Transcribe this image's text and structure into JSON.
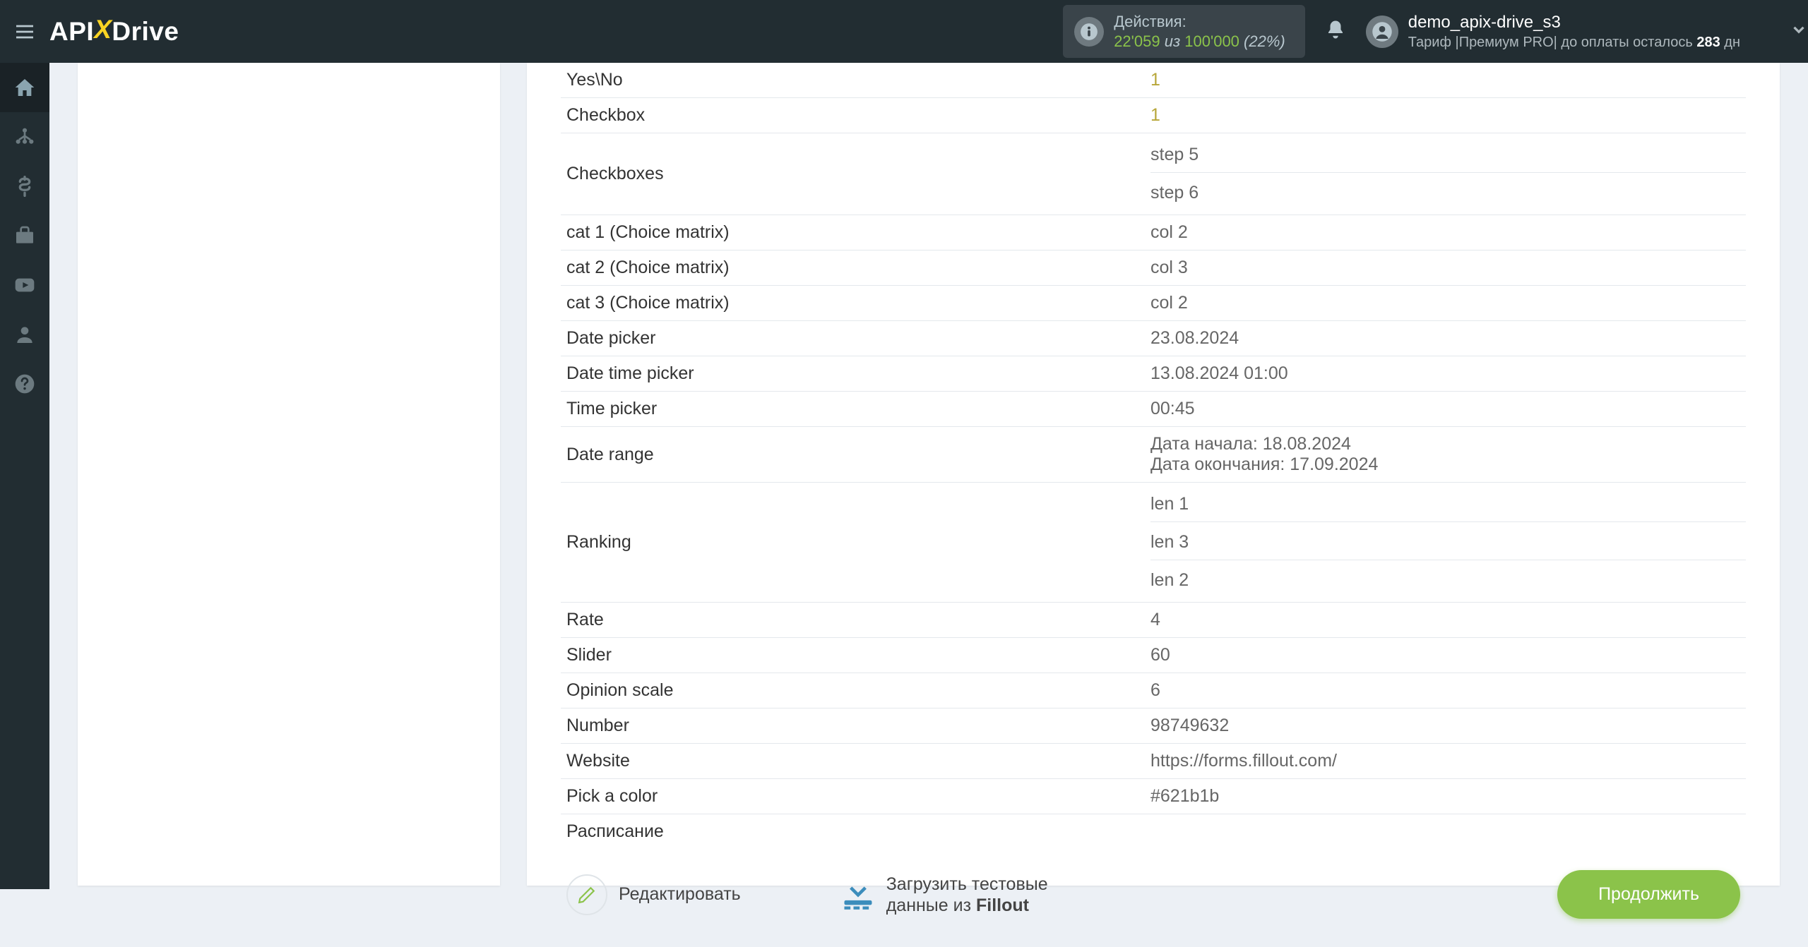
{
  "header": {
    "logo_a": "API",
    "logo_b": "Drive",
    "actions_label": "Действия:",
    "actions_used": "22'059",
    "actions_of": "из",
    "actions_total": "100'000",
    "actions_pct": "(22%)",
    "user_name": "demo_apix-drive_s3",
    "tariff_prefix": "Тариф |",
    "tariff_name": "Премиум PRO",
    "tariff_suffix": "| до оплаты осталось ",
    "tariff_days": "283",
    "tariff_unit": " дн"
  },
  "rows": [
    {
      "k": "Yes\\No",
      "v": [
        "1"
      ],
      "yel": true
    },
    {
      "k": "Checkbox",
      "v": [
        "1"
      ],
      "yel": true
    },
    {
      "k": "Checkboxes",
      "v": [
        "step 5",
        "step 6"
      ]
    },
    {
      "k": "cat 1 (Choice matrix)",
      "v": [
        "col 2"
      ]
    },
    {
      "k": "cat 2 (Choice matrix)",
      "v": [
        "col 3"
      ]
    },
    {
      "k": "cat 3 (Choice matrix)",
      "v": [
        "col 2"
      ]
    },
    {
      "k": "Date picker",
      "v": [
        "23.08.2024"
      ]
    },
    {
      "k": "Date time picker",
      "v": [
        "13.08.2024 01:00"
      ]
    },
    {
      "k": "Time picker",
      "v": [
        "00:45"
      ]
    },
    {
      "k": "Date range",
      "v": [
        "Дата начала: 18.08.2024\nДата окончания: 17.09.2024"
      ]
    },
    {
      "k": "Ranking",
      "v": [
        "len 1",
        "len 3",
        "len 2"
      ]
    },
    {
      "k": "Rate",
      "v": [
        "4"
      ]
    },
    {
      "k": "Slider",
      "v": [
        "60"
      ]
    },
    {
      "k": "Opinion scale",
      "v": [
        "6"
      ]
    },
    {
      "k": "Number",
      "v": [
        "98749632"
      ]
    },
    {
      "k": "Website",
      "v": [
        "https://forms.fillout.com/"
      ]
    },
    {
      "k": "Pick a color",
      "v": [
        "#621b1b"
      ]
    },
    {
      "k": "Расписание",
      "v": [
        ""
      ]
    }
  ],
  "footer": {
    "edit": "Редактировать",
    "load_l1": "Загрузить тестовые",
    "load_l2a": "данные из ",
    "load_l2b": "Fillout",
    "continue": "Продолжить"
  },
  "side": {
    "home": "home-icon",
    "flow": "flow-icon",
    "dollar": "dollar-icon",
    "briefcase": "briefcase-icon",
    "youtube": "youtube-icon",
    "user": "user-icon",
    "help": "help-icon"
  }
}
